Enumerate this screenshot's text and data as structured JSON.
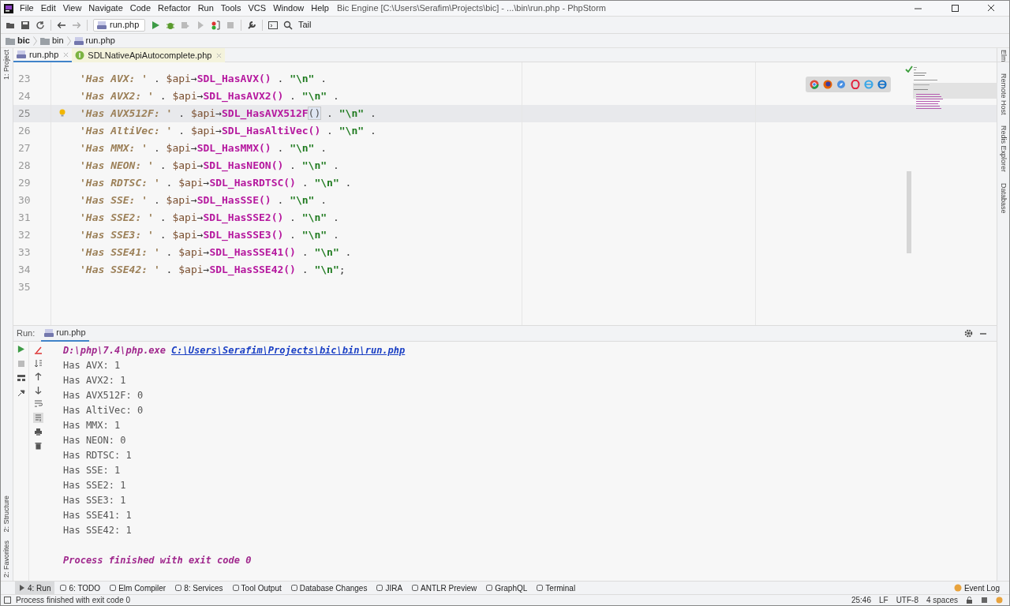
{
  "window": {
    "title": "Bic Engine [C:\\Users\\Serafim\\Projects\\bic] - ...\\bin\\run.php - PhpStorm"
  },
  "menu": [
    "File",
    "Edit",
    "View",
    "Navigate",
    "Code",
    "Refactor",
    "Run",
    "Tools",
    "VCS",
    "Window",
    "Help"
  ],
  "toolbar": {
    "run_config": "run.php",
    "search_label": "Tail"
  },
  "breadcrumbs": [
    {
      "kind": "folder",
      "label": "bic",
      "bold": true
    },
    {
      "kind": "folder",
      "label": "bin",
      "bold": false
    },
    {
      "kind": "php",
      "label": "run.php",
      "bold": false
    }
  ],
  "editor_tabs": [
    {
      "label": "run.php",
      "kind": "php",
      "selected": true
    },
    {
      "label": "SDLNativeApiAutocomplete.php",
      "kind": "interface",
      "selected": false
    }
  ],
  "left_stripe": {
    "top": [
      "1: Project"
    ],
    "bottom": [
      "2: Structure",
      "2: Favorites"
    ]
  },
  "right_stripe": [
    "Elm",
    "Remote Host",
    "Redis Explorer",
    "Database"
  ],
  "code_lines": [
    {
      "number": "23",
      "literal": "'Has AVX: '",
      "object": "$api",
      "arrow": "→",
      "method": "SDL_HasAVX()",
      "escape": "\"\\n\"",
      "end": ".",
      "current": false
    },
    {
      "number": "24",
      "literal": "'Has AVX2: '",
      "object": "$api",
      "arrow": "→",
      "method": "SDL_HasAVX2()",
      "escape": "\"\\n\"",
      "end": ".",
      "current": false
    },
    {
      "number": "25",
      "literal": "'Has AVX512F: '",
      "object": "$api",
      "arrow": "→",
      "method": "SDL_HasAVX512F()",
      "escape": "\"\\n\"",
      "end": ".",
      "current": true
    },
    {
      "number": "26",
      "literal": "'Has AltiVec: '",
      "object": "$api",
      "arrow": "→",
      "method": "SDL_HasAltiVec()",
      "escape": "\"\\n\"",
      "end": ".",
      "current": false
    },
    {
      "number": "27",
      "literal": "'Has MMX: '",
      "object": "$api",
      "arrow": "→",
      "method": "SDL_HasMMX()",
      "escape": "\"\\n\"",
      "end": ".",
      "current": false
    },
    {
      "number": "28",
      "literal": "'Has NEON: '",
      "object": "$api",
      "arrow": "→",
      "method": "SDL_HasNEON()",
      "escape": "\"\\n\"",
      "end": ".",
      "current": false
    },
    {
      "number": "29",
      "literal": "'Has RDTSC: '",
      "object": "$api",
      "arrow": "→",
      "method": "SDL_HasRDTSC()",
      "escape": "\"\\n\"",
      "end": ".",
      "current": false
    },
    {
      "number": "30",
      "literal": "'Has SSE: '",
      "object": "$api",
      "arrow": "→",
      "method": "SDL_HasSSE()",
      "escape": "\"\\n\"",
      "end": ".",
      "current": false
    },
    {
      "number": "31",
      "literal": "'Has SSE2: '",
      "object": "$api",
      "arrow": "→",
      "method": "SDL_HasSSE2()",
      "escape": "\"\\n\"",
      "end": ".",
      "current": false
    },
    {
      "number": "32",
      "literal": "'Has SSE3: '",
      "object": "$api",
      "arrow": "→",
      "method": "SDL_HasSSE3()",
      "escape": "\"\\n\"",
      "end": ".",
      "current": false
    },
    {
      "number": "33",
      "literal": "'Has SSE41: '",
      "object": "$api",
      "arrow": "→",
      "method": "SDL_HasSSE41()",
      "escape": "\"\\n\"",
      "end": ".",
      "current": false
    },
    {
      "number": "34",
      "literal": "'Has SSE42: '",
      "object": "$api",
      "arrow": "→",
      "method": "SDL_HasSSE42()",
      "escape": "\"\\n\"",
      "end": ";",
      "current": false
    },
    {
      "number": "35",
      "current": false
    }
  ],
  "run_panel": {
    "label": "Run:",
    "tab": "run.php",
    "command": "D:\\php\\7.4\\php.exe",
    "script_link": "C:\\Users\\Serafim\\Projects\\bic\\bin\\run.php",
    "output": [
      "Has AVX: 1",
      "Has AVX2: 1",
      "Has AVX512F: 0",
      "Has AltiVec: 0",
      "Has MMX: 1",
      "Has NEON: 0",
      "Has RDTSC: 1",
      "Has SSE: 1",
      "Has SSE2: 1",
      "Has SSE3: 1",
      "Has SSE41: 1",
      "Has SSE42: 1"
    ],
    "exit_message": "Process finished with exit code 0"
  },
  "tool_windows": [
    {
      "label": "4: Run",
      "selected": true
    },
    {
      "label": "6: TODO",
      "selected": false
    },
    {
      "label": "Elm Compiler",
      "selected": false
    },
    {
      "label": "8: Services",
      "selected": false
    },
    {
      "label": "Tool Output",
      "selected": false
    },
    {
      "label": "Database Changes",
      "selected": false
    },
    {
      "label": "JIRA",
      "selected": false
    },
    {
      "label": "ANTLR Preview",
      "selected": false
    },
    {
      "label": "GraphQL",
      "selected": false
    },
    {
      "label": "Terminal",
      "selected": false
    }
  ],
  "event_log": "Event Log",
  "status_bar": {
    "message": "Process finished with exit code 0",
    "position": "25:46",
    "line_separator": "LF",
    "encoding": "UTF-8",
    "indent": "4 spaces"
  }
}
